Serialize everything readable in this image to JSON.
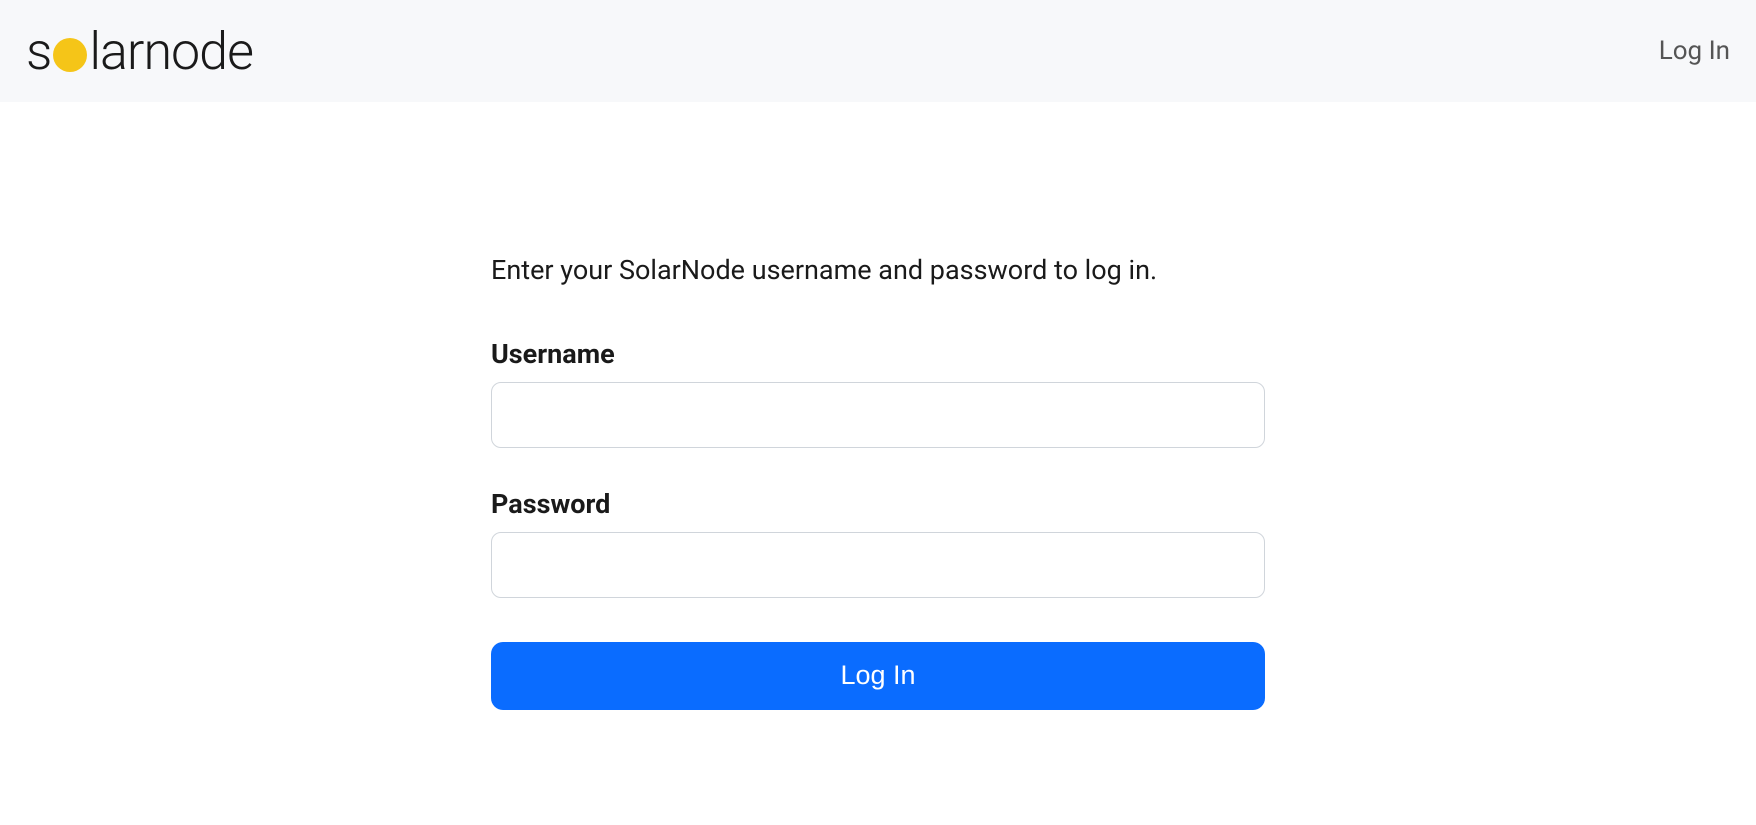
{
  "header": {
    "logo_text_before": "s",
    "logo_text_after": "larnode",
    "nav_login": "Log In"
  },
  "login": {
    "instruction": "Enter your SolarNode username and password to log in.",
    "username_label": "Username",
    "username_value": "",
    "password_label": "Password",
    "password_value": "",
    "submit_label": "Log In"
  }
}
